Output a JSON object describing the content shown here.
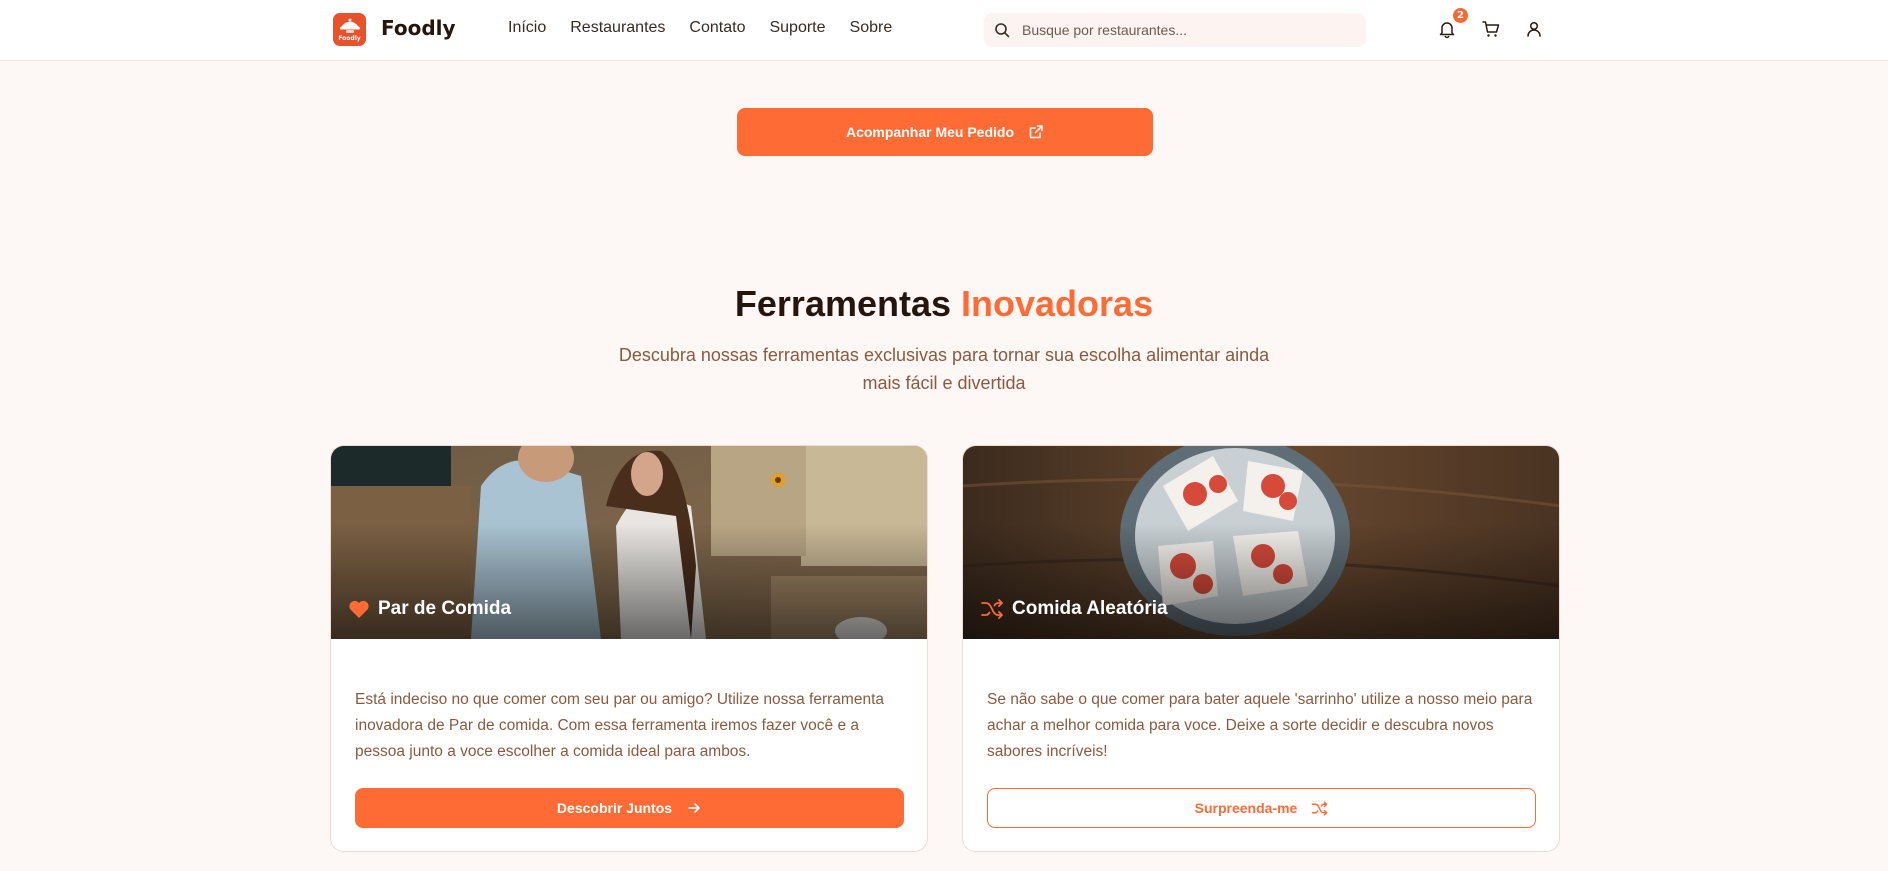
{
  "header": {
    "logo_mini_text": "Foodly",
    "brand": "Foodly",
    "nav": [
      "Início",
      "Restaurantes",
      "Contato",
      "Suporte",
      "Sobre"
    ],
    "search_placeholder": "Busque por restaurantes...",
    "notification_count": "2",
    "icons": [
      "bell-icon",
      "cart-icon",
      "user-icon",
      "search-icon"
    ]
  },
  "track_button": {
    "label": "Acompanhar Meu Pedido",
    "icon": "external-link-icon"
  },
  "section": {
    "title_main": "Ferramentas",
    "title_accent": "Inovadoras",
    "subtitle": "Descubra nossas ferramentas exclusivas para tornar sua escolha alimentar ainda mais fácil e divertida"
  },
  "cards": [
    {
      "title": "Par de Comida",
      "icon": "heart-icon",
      "description": "Está indeciso no que comer com seu par ou amigo? Utilize nossa ferramenta inovadora de Par de comida. Com essa ferramenta iremos fazer você e a pessoa junto a voce escolher a comida ideal para ambos.",
      "button": "Descobrir Juntos",
      "button_icon": "arrow-right-icon"
    },
    {
      "title": "Comida Aleatória",
      "icon": "shuffle-icon",
      "description": "Se não sabe o que comer para bater aquele 'sarrinho' utilize a nosso meio para achar a melhor comida para voce. Deixe a sorte decidir e descubra novos sabores incríveis!",
      "button": "Surpreenda-me",
      "button_icon": "shuffle-icon"
    }
  ],
  "colors": {
    "accent": "#fe6b35",
    "logo": "#e8512a",
    "text_muted": "#8a5a3e"
  }
}
